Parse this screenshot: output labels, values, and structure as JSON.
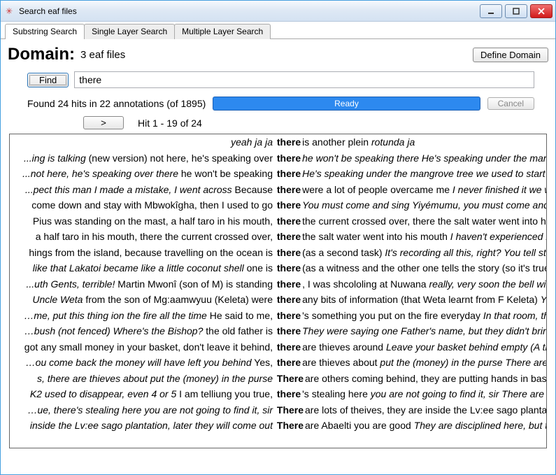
{
  "window": {
    "title": "Search eaf files"
  },
  "tabs": {
    "t0": "Substring Search",
    "t1": "Single Layer Search",
    "t2": "Multiple Layer Search"
  },
  "domain": {
    "label": "Domain:",
    "info": "3 eaf files",
    "define_label": "Define Domain"
  },
  "search": {
    "find_label": "Find",
    "value": "there"
  },
  "status": {
    "text": "Found 24 hits in 22 annotations (of 1895)",
    "progress_label": "Ready",
    "cancel_label": "Cancel"
  },
  "nav": {
    "next_label": ">",
    "range": "Hit 1 - 19 of 24"
  },
  "results": [
    {
      "left_i": "yeah  ja  ja",
      "left_r": "",
      "hit": "there",
      "right_r": " is another plein",
      "right_i": "rotunda  ja"
    },
    {
      "left_i": "...ing is talking",
      "left_r": " (new version) not here, he's speaking over",
      "hit": "there",
      "right_r": "",
      "right_i": "he won't be speaking there  He's speaking under the mang…"
    },
    {
      "left_i": "...not here, he's speaking over there",
      "left_r": " he won't be speaking",
      "hit": "there",
      "right_r": "",
      "right_i": "He's speaking under the mangrove tree    we used to start"
    },
    {
      "left_i": "...pect this man  I made a mistake, I went across",
      "left_r": " Because",
      "hit": "there",
      "right_r": " were a lot of people overcame me",
      "right_i": "I never finished it  we wo"
    },
    {
      "left_i": "",
      "left_r": "come down and stay with Mbwokîgha, then I used to go",
      "hit": "there",
      "right_r": "",
      "right_i": "You must come and sing Yiyémumu, you must come and jo"
    },
    {
      "left_i": "",
      "left_r": "Pius was standing on the mast, a half taro in his mouth,",
      "hit": "there",
      "right_r": " the current crossed over, there the salt water went into his ",
      "right_i": ""
    },
    {
      "left_i": "",
      "left_r": "a half taro in his mouth, there the current crossed over,",
      "hit": "there",
      "right_r": " the salt water went into his mouth",
      "right_i": "I haven't experienced it "
    },
    {
      "left_i": "",
      "left_r": "hings from the island, because travelling on the ocean is",
      "hit": "there",
      "right_r": " (as a second task)",
      "right_i": "It's recording all this, right?  You tell sto"
    },
    {
      "left_i": "like that  Lakatoi became like a little coconut shell",
      "left_r": " one is",
      "hit": "there",
      "right_r": " (as a witness and the other one tells the story (so it's true), ",
      "right_i": ""
    },
    {
      "left_i": "...uth  Gents, terrible!",
      "left_r": " Martin Mwonî (son of M) is standing",
      "hit": "there",
      "right_r": ", I was shcololing at Nuwana",
      "right_i": "really, very soon the bell will s"
    },
    {
      "left_i": "Uncle Weta",
      "left_r": " from the son of Mg:aamwyuu (Keleta) were",
      "hit": "there",
      "right_r": " any bits of information (that Weta learnt from F Keleta)",
      "right_i": "You"
    },
    {
      "left_i": "…me, put this thing ion the fire all the time",
      "left_r": " He said to me,",
      "hit": "there",
      "right_r": "'s something you put on the fire everyday",
      "right_i": "In that room, thbe"
    },
    {
      "left_i": "…bush (not fenced)  Where's the Bishop?",
      "left_r": " the old father is",
      "hit": "there",
      "right_r": "",
      "right_i": "They were saying one Father's name, but they didn't brinb"
    },
    {
      "left_i": "",
      "left_r": "got any small money in your basket, don't leave it behind,",
      "hit": "there",
      "right_r": " are thieves around",
      "right_i": "Leave your basket behind empty  (A th"
    },
    {
      "left_i": "…ou come back the money will have left you behind",
      "left_r": " Yes,",
      "hit": "there",
      "right_r": " are thieves about",
      "right_i": "put the (money) in the purse  There are "
    },
    {
      "left_i": "s, there are thieves about  put the (money) in the purse",
      "left_r": "",
      "hit": "There",
      "right_r": " are others coming behind, they are putting hands in baske",
      "right_i": ""
    },
    {
      "left_i": "K2 used to disappear, even 4 or 5",
      "left_r": " I am telliung you true,",
      "hit": "there",
      "right_r": "'s stealing here",
      "right_i": "you are not going to find it, sir  There are lo"
    },
    {
      "left_i": "…ue, there's stealing here  you are not going to find it, sir",
      "left_r": "",
      "hit": "There",
      "right_r": " are lots of theives, they are inside the Lv:ee sago plantatio",
      "right_i": ""
    },
    {
      "left_i": "inside the Lv:ee sago plantation, later they will come out",
      "left_r": "",
      "hit": "There",
      "right_r": " are Abaelti you are good",
      "right_i": "They are disciplined here, but th"
    }
  ]
}
